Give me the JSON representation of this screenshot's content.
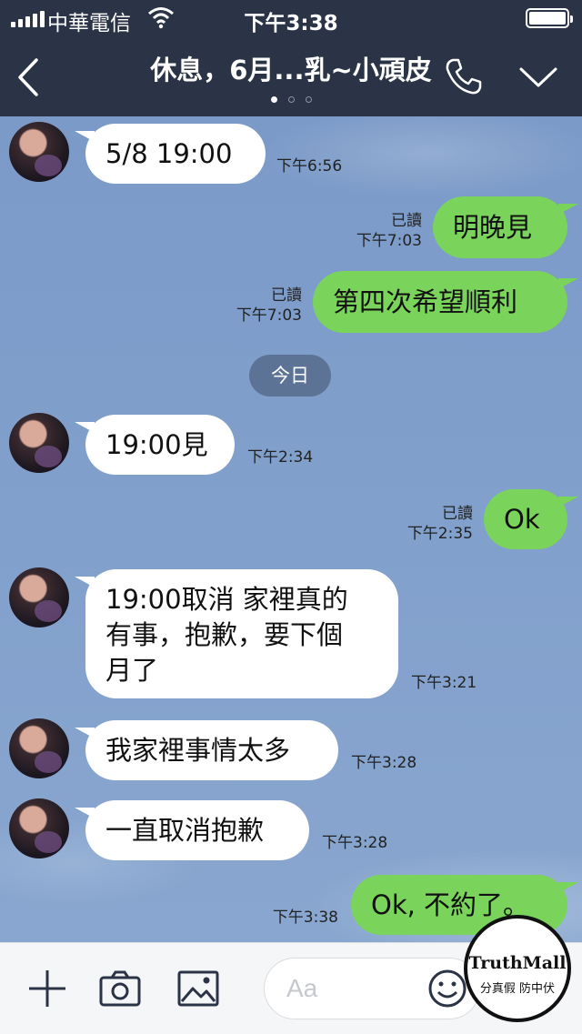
{
  "status_bar": {
    "carrier": "中華電信",
    "time": "下午3:38"
  },
  "header": {
    "title": "休息，6月...乳~小頑皮"
  },
  "day_separator": "今日",
  "messages": [
    {
      "side": "in",
      "text": "5/8  19:00",
      "time": "下午6:56"
    },
    {
      "side": "out",
      "text": "明晚見",
      "read": "已讀",
      "time": "下午7:03"
    },
    {
      "side": "out",
      "text": "第四次希望順利",
      "read": "已讀",
      "time": "下午7:03"
    },
    {
      "side": "in",
      "text": "19:00見",
      "time": "下午2:34"
    },
    {
      "side": "out",
      "text": "Ok",
      "read": "已讀",
      "time": "下午2:35"
    },
    {
      "side": "in",
      "lines": [
        "19:00取消 家裡真的",
        "有事，抱歉，要下個",
        "月了"
      ],
      "time": "下午3:21"
    },
    {
      "side": "in",
      "text": "我家裡事情太多",
      "time": "下午3:28"
    },
    {
      "side": "in",
      "text": "一直取消抱歉",
      "time": "下午3:28"
    },
    {
      "side": "out",
      "text": "Ok, 不約了。",
      "time": "下午3:38"
    }
  ],
  "input": {
    "placeholder": "Aa"
  },
  "watermark": {
    "brand": "TruthMall",
    "slogan": "分真假 防中伏"
  },
  "colors": {
    "header_bg": "#2b3446",
    "chat_bg": "#7d9bc7",
    "outgoing_bubble": "#7ad35a",
    "incoming_bubble": "#ffffff"
  },
  "icons": [
    "signal-icon",
    "wifi-icon",
    "battery-icon",
    "back-icon",
    "phone-icon",
    "chevron-down-icon",
    "plus-icon",
    "camera-icon",
    "image-icon",
    "emoji-icon"
  ]
}
